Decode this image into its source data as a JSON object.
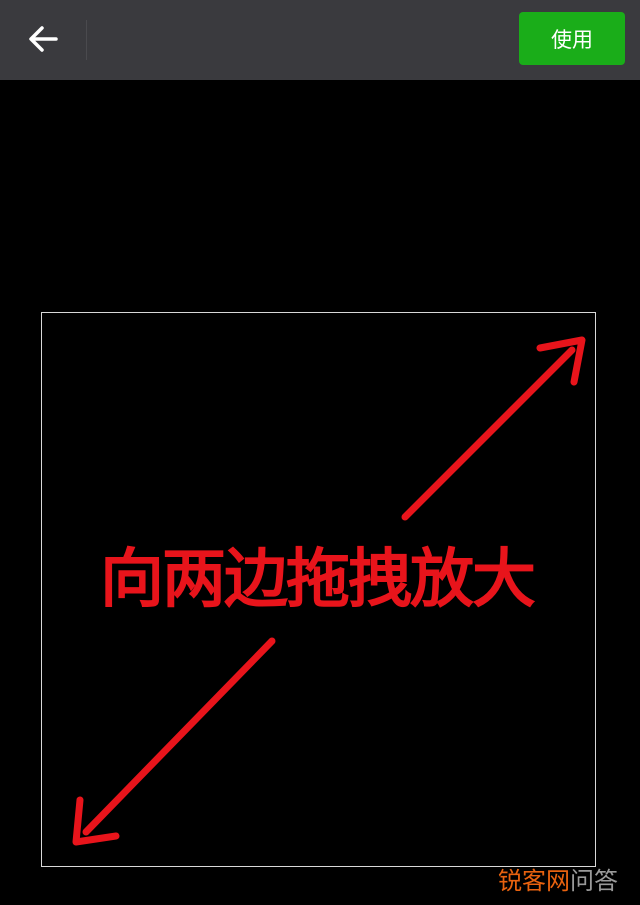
{
  "toolbar": {
    "back_icon": "arrow-left-icon",
    "use_label": "使用",
    "use_color": "#1aad19",
    "background": "#3a3a3e"
  },
  "crop": {
    "instruction": "向两边拖拽放大",
    "instruction_color": "#e8141b",
    "arrow_icons": [
      "arrow-up-right-icon",
      "arrow-down-left-icon"
    ]
  },
  "watermark": {
    "brand": "锐客网",
    "suffix": "问答",
    "brand_color": "#e8620f"
  }
}
